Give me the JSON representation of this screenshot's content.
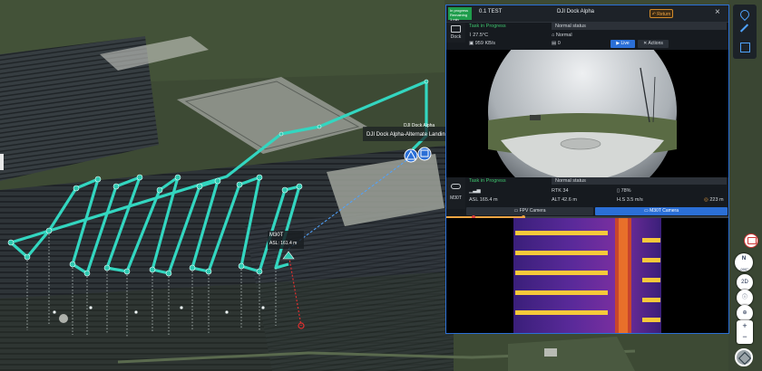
{
  "map": {
    "dock_label": "DJI Dock Alpha",
    "landing_label": "DJI Dock Alpha-Alternate Landing S",
    "drone_label": "M30T",
    "drone_alt": "ASL: 161.4 m"
  },
  "panel": {
    "status_tag": "In progress Remaining 1 min",
    "task_name": "0.1 TEST",
    "dock_name": "DJI Dock Alpha",
    "return_label": "Return",
    "close_label": "×",
    "dock": {
      "device_label": "Dock",
      "task_status": "Task in Progress",
      "status": "Normal status",
      "temperature": "27.5°C",
      "mode": "Normal",
      "network": "959 KB/s",
      "count": "0",
      "live_label": "Live",
      "actions_label": "Actions"
    },
    "drone": {
      "device_label": "M30T",
      "task_status": "Task in Progress",
      "status": "Normal status",
      "signal": "",
      "rtk": "RTK 34",
      "battery": "78%",
      "asl": "ASL 165.4 m",
      "alt": "ALT 42.6 m",
      "hspeed": "H.S 3.5 m/s",
      "distance": "223 m",
      "fpv_label": "FPV Camera",
      "camera_label": "M30T Camera"
    }
  },
  "rightbar": {
    "compass": "N",
    "heading": "-000°",
    "view_2d": "2D"
  },
  "colors": {
    "accent": "#2b6fd6",
    "route": "#33d6c0",
    "success": "#1f9d4c",
    "warning": "#f0a543"
  }
}
